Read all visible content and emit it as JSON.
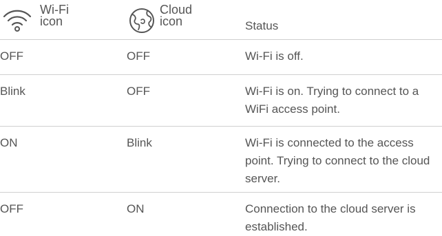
{
  "header": {
    "wifi_label": "Wi-Fi\nicon",
    "cloud_label": "Cloud\nicon",
    "status_label": "Status",
    "wifi_icon": "wifi-icon",
    "cloud_icon": "cloud-globe-icon"
  },
  "rows": [
    {
      "wifi": "OFF",
      "cloud": "OFF",
      "status": "Wi-Fi is off."
    },
    {
      "wifi": "Blink",
      "cloud": "OFF",
      "status": "Wi-Fi is on. Trying to connect to a WiFi access point."
    },
    {
      "wifi": "ON",
      "cloud": "Blink",
      "status": "Wi-Fi is connected to the access point. Trying to connect to the cloud server."
    },
    {
      "wifi": "OFF",
      "cloud": "ON",
      "status": "Connection to the cloud server is established."
    }
  ],
  "colors": {
    "text": "#555555",
    "divider": "#cfcfcf"
  }
}
